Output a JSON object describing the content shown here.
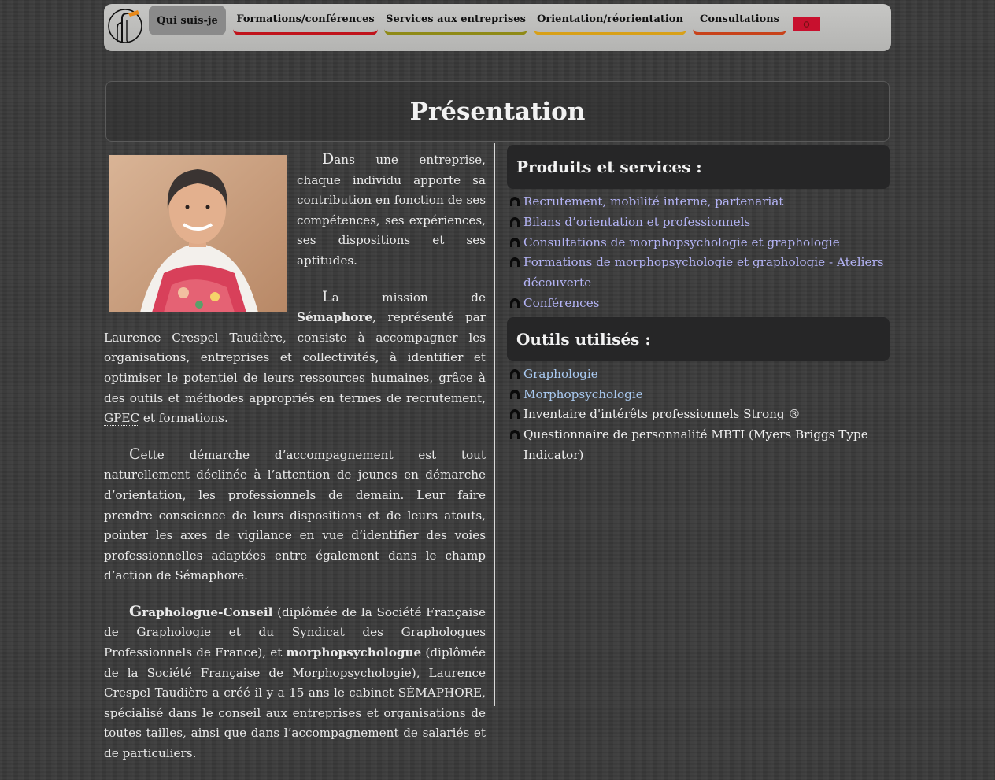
{
  "nav": {
    "tabs": [
      {
        "label": "Qui suis-je",
        "color": "#8a8a8a"
      },
      {
        "label": "Formations/conférences",
        "color": "#c0131b"
      },
      {
        "label": "Services aux entreprises",
        "color": "#8f8a17"
      },
      {
        "label": "Orientation/réorientation",
        "color": "#d8a018"
      },
      {
        "label": "Consultations",
        "color": "#c8421a"
      }
    ]
  },
  "page": {
    "title": "Présentation"
  },
  "intro": {
    "p1_cap": "D",
    "p1": "ans une entreprise, chaque individu apporte sa contribution en fonction de ses compétences, ses expériences, ses dispositions et ses aptitudes.",
    "p2_cap": "L",
    "p2_a": "a mission de ",
    "p2_b": "Sémaphore",
    "p2_c": ", représenté par Laurence Crespel Taudière, consiste à accompagner les organisations, entreprises et collectivités, à identifier et optimiser le potentiel de leurs ressources humaines, grâce à des outils et méthodes appropriés en termes de recrutement, ",
    "p2_abbr": "GPEC",
    "p2_d": " et formations.",
    "p3_cap": "C",
    "p3": "ette démarche d’accompagnement est tout naturellement déclinée à l’attention de jeunes en démarche d’orientation, les professionnels de demain. Leur faire prendre conscience de leurs dispositions et de leurs atouts, pointer les axes de vigilance en vue d’identifier des voies professionnelles adaptées entre également dans le champ d’action de Sémaphore.",
    "p4_cap": "G",
    "p4_a": "raphologue-Conseil",
    "p4_b": " (diplômée de la Société Française de Graphologie et du Syndicat des Graphologues Professionnels de France), et ",
    "p4_c": "morphopsychologue",
    "p4_d": " (diplômée de la Société Française de Morphopsychologie), Laurence Crespel Taudière a créé il y a 15 ans le cabinet SÉMAPHORE, spécialisé dans le conseil aux entreprises et organisations de toutes tailles, ainsi que dans l’accompagnement de salariés et de particuliers."
  },
  "products": {
    "heading": "Produits et services :",
    "items": [
      "Recrutement, mobilité interne, partenariat",
      "Bilans d’orientation et professionnels",
      "Consultations de morphopsychologie et graphologie",
      "Formations de morphopsychologie et graphologie - Ateliers découverte",
      "Conférences"
    ]
  },
  "tools": {
    "heading": "Outils utilisés :",
    "items": [
      "Graphologie",
      "Morphopsychologie",
      "Inventaire d'intérêts professionnels Strong ®",
      "Questionnaire de personnalité MBTI (Myers Briggs Type Indicator)"
    ]
  },
  "icons": {
    "logo": "logo-icon",
    "bullet": "semaphore-bullet-icon",
    "flag": "flag-icon"
  }
}
